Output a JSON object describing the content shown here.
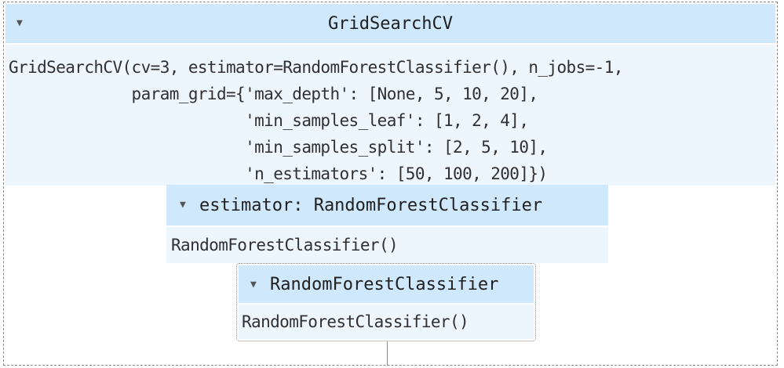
{
  "grid_search": {
    "title": "GridSearchCV",
    "toggle_icon": "triangle-down-icon",
    "repr": "GridSearchCV(cv=3, estimator=RandomForestClassifier(), n_jobs=-1,\n             param_grid={'max_depth': [None, 5, 10, 20],\n                         'min_samples_leaf': [1, 2, 4],\n                         'min_samples_split': [2, 5, 10],\n                         'n_estimators': [50, 100, 200]})"
  },
  "estimator_param": {
    "title": "estimator: RandomForestClassifier",
    "toggle_icon": "triangle-down-icon",
    "repr": "RandomForestClassifier()"
  },
  "random_forest": {
    "title": "RandomForestClassifier",
    "toggle_icon": "triangle-down-icon",
    "repr": "RandomForestClassifier()"
  },
  "colors": {
    "header_bg": "#d0e8fc",
    "body_bg": "#edf5fd",
    "border": "#8a8a8a"
  }
}
